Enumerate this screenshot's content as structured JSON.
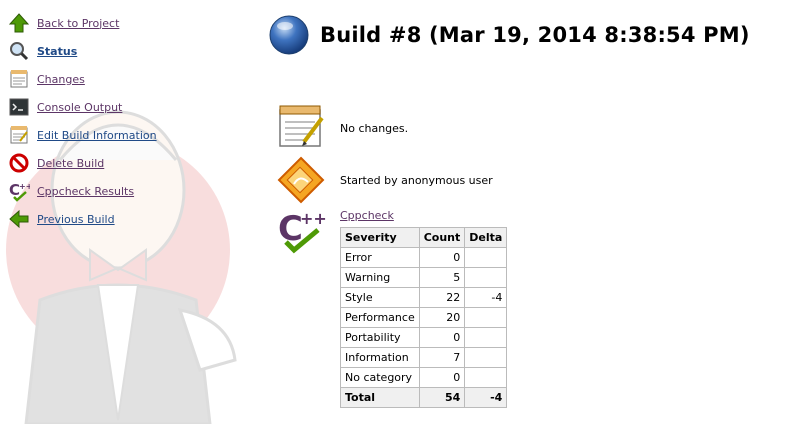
{
  "sidebar": {
    "items": [
      {
        "label": "Back to Project",
        "icon": "up-arrow-icon"
      },
      {
        "label": "Status",
        "icon": "magnifier-icon"
      },
      {
        "label": "Changes",
        "icon": "notepad-icon"
      },
      {
        "label": "Console Output",
        "icon": "terminal-icon"
      },
      {
        "label": "Edit Build Information",
        "icon": "notepad-icon"
      },
      {
        "label": "Delete Build",
        "icon": "no-entry-icon"
      },
      {
        "label": "Cppcheck Results",
        "icon": "cppcheck-icon"
      },
      {
        "label": "Previous Build",
        "icon": "left-arrow-icon"
      }
    ]
  },
  "header": {
    "title": "Build #8 (Mar 19, 2014 8:38:54 PM)",
    "status_color": "#3465a4"
  },
  "summary": {
    "changes_text": "No changes.",
    "cause_text": "Started by anonymous user",
    "cppcheck_link": "Cppcheck"
  },
  "cppcheck_table": {
    "headers": [
      "Severity",
      "Count",
      "Delta"
    ],
    "rows": [
      {
        "severity": "Error",
        "count": "0",
        "delta": ""
      },
      {
        "severity": "Warning",
        "count": "5",
        "delta": ""
      },
      {
        "severity": "Style",
        "count": "22",
        "delta": "-4"
      },
      {
        "severity": "Performance",
        "count": "20",
        "delta": ""
      },
      {
        "severity": "Portability",
        "count": "0",
        "delta": ""
      },
      {
        "severity": "Information",
        "count": "7",
        "delta": ""
      },
      {
        "severity": "No category",
        "count": "0",
        "delta": ""
      }
    ],
    "total": {
      "severity": "Total",
      "count": "54",
      "delta": "-4"
    }
  }
}
